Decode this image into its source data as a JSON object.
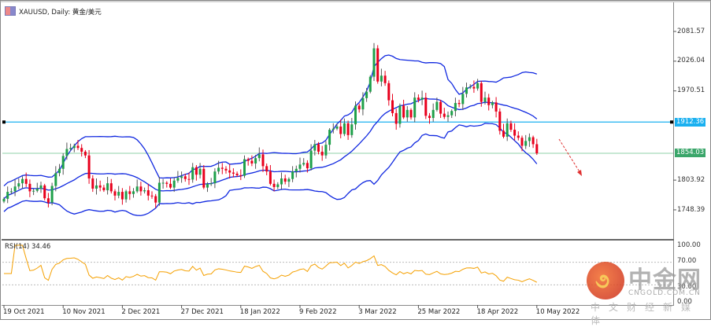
{
  "header": {
    "title": "XAUUSD, Daily:  黄金/美元"
  },
  "price_axis": {
    "labels": [
      "2081.57",
      "2026.04",
      "1970.51",
      "1803.92",
      "1748.39"
    ],
    "values": [
      2081.57,
      2026.04,
      1970.51,
      1803.92,
      1748.39
    ]
  },
  "tags": {
    "line_price": "1912.36",
    "last_price": "1854.03",
    "line_color": "#1ab0f0",
    "last_color": "#3aa66a"
  },
  "rsi": {
    "title": "RSI(14) 34.46",
    "labels": [
      "100.00",
      "70.00",
      "30.00",
      "0.00"
    ],
    "values": [
      100,
      70,
      30,
      0
    ]
  },
  "watermark": {
    "brand": "中金网",
    "url": "CNGOLD.COM.CN",
    "sub": "中文财经新媒体"
  },
  "chart_data": {
    "type": "candlestick",
    "symbol": "XAUUSD",
    "timeframe": "Daily",
    "x_tick_labels": [
      "19 Oct 2021",
      "10 Nov 2021",
      "2 Dec 2021",
      "27 Dec 2021",
      "18 Jan 2022",
      "9 Feb 2022",
      "3 Mar 2022",
      "25 Mar 2022",
      "18 Apr 2022",
      "10 May 2022"
    ],
    "x_tick_index": [
      0,
      16,
      32,
      48,
      64,
      80,
      96,
      112,
      128,
      144
    ],
    "ylim": [
      1715,
      2095
    ],
    "indicators": [
      "Bollinger Bands(20,2)",
      "RSI(14)"
    ],
    "colors": {
      "bull": "#1fa04a",
      "bear": "#e8001c",
      "bands": "#1028e0",
      "rsi": "#f5a000"
    },
    "close": [
      1769,
      1782,
      1783,
      1792,
      1798,
      1806,
      1797,
      1783,
      1784,
      1788,
      1794,
      1770,
      1762,
      1793,
      1817,
      1825,
      1849,
      1862,
      1864,
      1868,
      1864,
      1857,
      1850,
      1807,
      1788,
      1794,
      1790,
      1785,
      1798,
      1783,
      1775,
      1782,
      1768,
      1783,
      1778,
      1783,
      1792,
      1783,
      1785,
      1775,
      1774,
      1762,
      1799,
      1799,
      1797,
      1790,
      1803,
      1808,
      1811,
      1806,
      1805,
      1828,
      1814,
      1825,
      1790,
      1797,
      1798,
      1820,
      1827,
      1825,
      1822,
      1818,
      1816,
      1813,
      1812,
      1843,
      1840,
      1835,
      1845,
      1852,
      1830,
      1820,
      1797,
      1791,
      1796,
      1807,
      1801,
      1806,
      1820,
      1825,
      1833,
      1836,
      1826,
      1859,
      1871,
      1857,
      1850,
      1870,
      1898,
      1900,
      1904,
      1890,
      1910,
      1888,
      1908,
      1943,
      1936,
      1957,
      1969,
      1997,
      2050,
      1988,
      1999,
      1985,
      1953,
      1929,
      1909,
      1943,
      1921,
      1935,
      1921,
      1958,
      1954,
      1958,
      1924,
      1920,
      1935,
      1950,
      1928,
      1922,
      1925,
      1933,
      1948,
      1946,
      1965,
      1977,
      1978,
      1975,
      1985,
      1950,
      1958,
      1944,
      1949,
      1932,
      1896,
      1885,
      1910,
      1898,
      1887,
      1883,
      1868,
      1877,
      1884,
      1871,
      1854.03
    ],
    "horizontal_lines": [
      1912.36,
      1854.03
    ],
    "annotation": "red dashed down arrow after last bar"
  }
}
